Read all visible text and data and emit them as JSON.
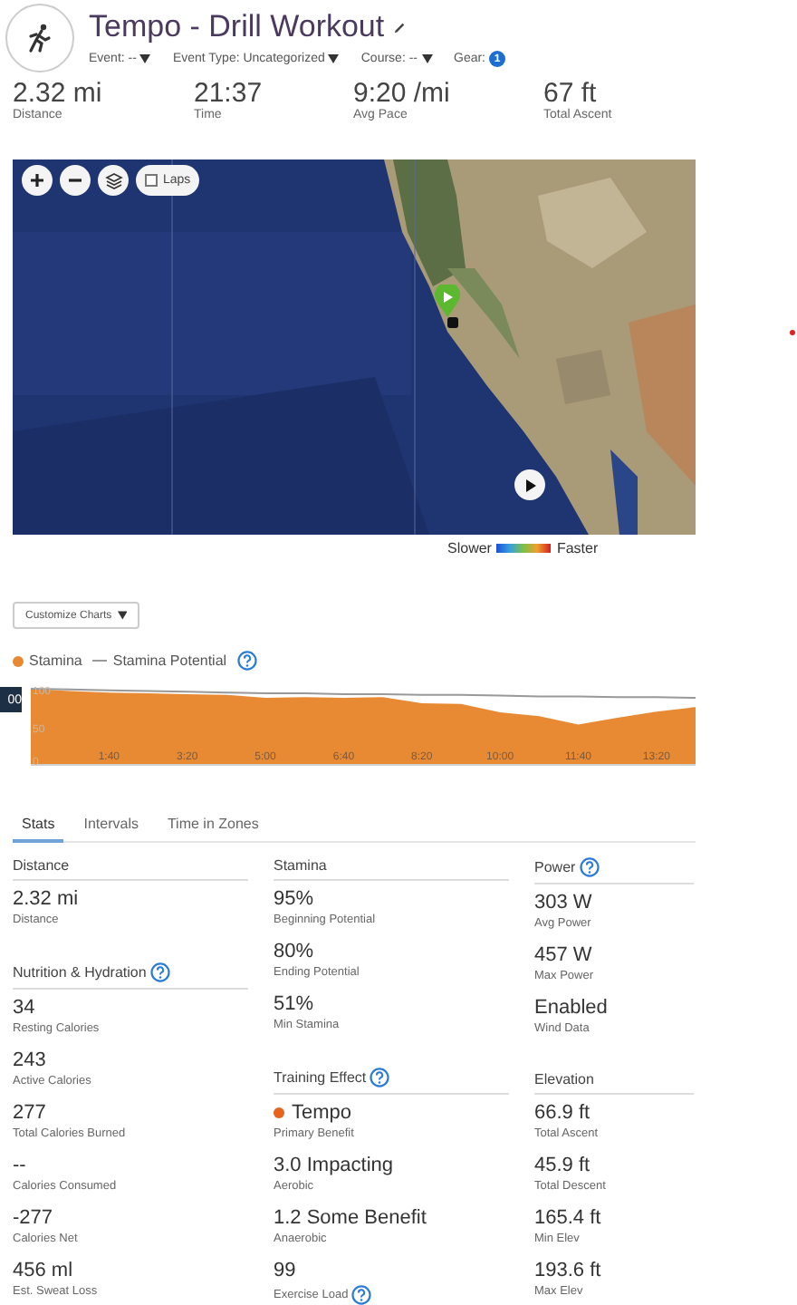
{
  "activity": {
    "title": "Tempo - Drill Workout",
    "meta": [
      {
        "label": "Event: --",
        "kind": "dropdown"
      },
      {
        "label": "Event Type: Uncategorized",
        "kind": "dropdown"
      },
      {
        "label": "Course: --",
        "kind": "dropdown"
      },
      {
        "label": "Gear:",
        "kind": "badge",
        "badge": "1"
      }
    ]
  },
  "summary": [
    {
      "value": "2.32 mi",
      "label": "Distance"
    },
    {
      "value": "21:37",
      "label": "Time"
    },
    {
      "value": "9:20 /mi",
      "label": "Avg Pace"
    },
    {
      "value": "67 ft",
      "label": "Total Ascent"
    }
  ],
  "map": {
    "kind": "picture",
    "laps": {
      "label": "Laps",
      "checked": false
    }
  },
  "speed_legend": {
    "slower": "Slower",
    "faster": "Faster"
  },
  "customize_button": "Customize Charts",
  "chart": {
    "cursor_label": "00",
    "help": true,
    "chart_data": {
      "type": "area",
      "x": [
        0,
        50,
        100,
        150,
        200,
        250,
        300,
        350,
        400,
        450,
        500,
        550,
        600,
        650,
        700,
        750,
        800,
        850
      ],
      "xlim": [
        0,
        850
      ],
      "ylim": [
        0,
        100
      ],
      "xticks": [
        {
          "value": 100,
          "label": "1:40"
        },
        {
          "value": 200,
          "label": "3:20"
        },
        {
          "value": 300,
          "label": "5:00"
        },
        {
          "value": 400,
          "label": "6:40"
        },
        {
          "value": 500,
          "label": "8:20"
        },
        {
          "value": 600,
          "label": "10:00"
        },
        {
          "value": 700,
          "label": "11:40"
        },
        {
          "value": 800,
          "label": "13:20"
        }
      ],
      "yticks": [
        {
          "value": 0,
          "label": "0"
        },
        {
          "value": 50,
          "label": "50"
        },
        {
          "value": 100,
          "label": "100"
        }
      ],
      "series": [
        {
          "name": "Stamina",
          "color": "#e88a33",
          "values": [
            100,
            97,
            95,
            94,
            93,
            92,
            88,
            89,
            88,
            89,
            81,
            80,
            69,
            64,
            53,
            62,
            70,
            76
          ]
        },
        {
          "name": "Stamina Potential",
          "type": "line",
          "color": "#999999",
          "values": [
            100,
            99,
            98,
            97,
            96,
            95,
            94,
            94,
            93,
            93,
            92,
            92,
            91,
            90,
            90,
            89,
            89,
            88
          ]
        }
      ]
    }
  },
  "tabs": [
    {
      "label": "Stats",
      "selected": true
    },
    {
      "label": "Intervals",
      "selected": false
    },
    {
      "label": "Time in Zones",
      "selected": false
    }
  ],
  "stat_columns": [
    [
      {
        "title": "Distance",
        "items": [
          {
            "value": "2.32 mi",
            "label": "Distance"
          }
        ]
      },
      {
        "title": "Nutrition & Hydration",
        "help": true,
        "items": [
          {
            "value": "34",
            "label": "Resting Calories"
          },
          {
            "value": "243",
            "label": "Active Calories"
          },
          {
            "value": "277",
            "label": "Total Calories Burned"
          },
          {
            "value": "--",
            "label": "Calories Consumed"
          },
          {
            "value": "-277",
            "label": "Calories Net"
          },
          {
            "value": "456 ml",
            "label": "Est. Sweat Loss"
          }
        ]
      }
    ],
    [
      {
        "title": "Stamina",
        "items": [
          {
            "value": "95%",
            "label": "Beginning Potential"
          },
          {
            "value": "80%",
            "label": "Ending Potential"
          },
          {
            "value": "51%",
            "label": "Min Stamina"
          }
        ]
      },
      {
        "title": "Training Effect",
        "help": true,
        "items": [
          {
            "value": "Tempo",
            "label": "Primary Benefit",
            "color": "#e8641e"
          },
          {
            "value": "3.0 Impacting",
            "label": "Aerobic"
          },
          {
            "value": "1.2 Some Benefit",
            "label": "Anaerobic"
          },
          {
            "value": "99",
            "label": "Exercise Load",
            "help": true
          }
        ]
      }
    ],
    [
      {
        "title": "Power",
        "help": true,
        "items": [
          {
            "value": "303 W",
            "label": "Avg Power"
          },
          {
            "value": "457 W",
            "label": "Max Power"
          },
          {
            "value": "Enabled",
            "label": "Wind Data"
          }
        ]
      },
      {
        "title": "Elevation",
        "items": [
          {
            "value": "66.9 ft",
            "label": "Total Ascent"
          },
          {
            "value": "45.9 ft",
            "label": "Total Descent"
          },
          {
            "value": "165.4 ft",
            "label": "Min Elev"
          },
          {
            "value": "193.6 ft",
            "label": "Max Elev"
          }
        ]
      }
    ]
  ]
}
